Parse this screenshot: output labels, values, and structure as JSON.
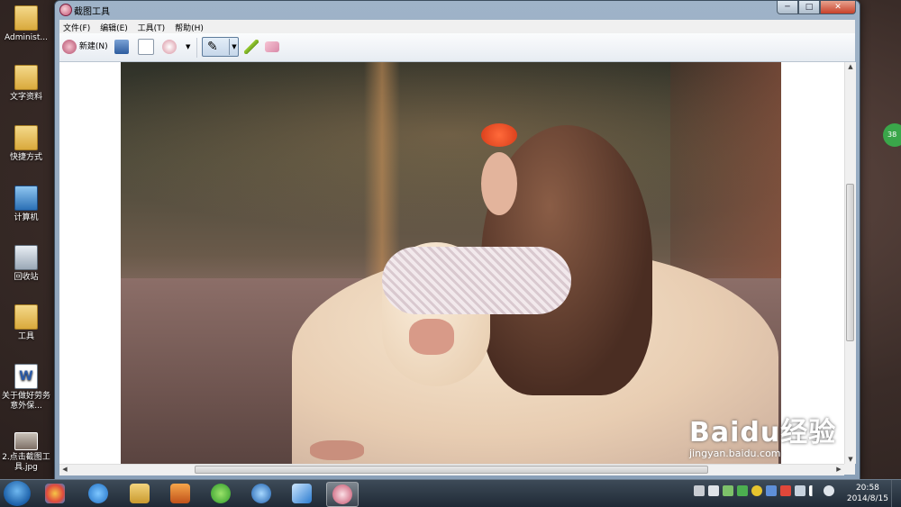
{
  "desktop": {
    "icons": [
      {
        "label": "Administ...",
        "kind": "folder"
      },
      {
        "label": "文字资料",
        "kind": "folder"
      },
      {
        "label": "快捷方式",
        "kind": "folder"
      },
      {
        "label": "计算机",
        "kind": "computer"
      },
      {
        "label": "回收站",
        "kind": "recycle-bin"
      },
      {
        "label": "工具",
        "kind": "folder"
      },
      {
        "label": "关于做好劳务意外保...",
        "kind": "word-document"
      },
      {
        "label": "2.点击截图工具.jpg",
        "kind": "image-file"
      }
    ],
    "side_badge": "38"
  },
  "window": {
    "title": "截图工具",
    "menu": [
      "文件(F)",
      "编辑(E)",
      "工具(T)",
      "帮助(H)"
    ],
    "toolbar": {
      "new_label": "新建(N)",
      "icons": [
        "scissors-icon",
        "save-icon",
        "copy-icon",
        "send-email-icon",
        "pen-icon",
        "highlighter-icon",
        "eraser-icon"
      ]
    },
    "controls": {
      "minimize": "─",
      "maximize": "□",
      "close": "✕"
    }
  },
  "watermark": {
    "main": "Baidu经验",
    "sub": "jingyan.baidu.com"
  },
  "taskbar": {
    "apps": [
      "start-orb",
      "color-balls-app",
      "internet-explorer",
      "file-explorer",
      "media-player",
      "browser-360",
      "qq-app",
      "feiq-app",
      "snipping-tool"
    ],
    "time": "20:58",
    "date": "2014/8/15"
  },
  "colors": {
    "accent": "#1b5fa8",
    "close": "#c7402a"
  }
}
